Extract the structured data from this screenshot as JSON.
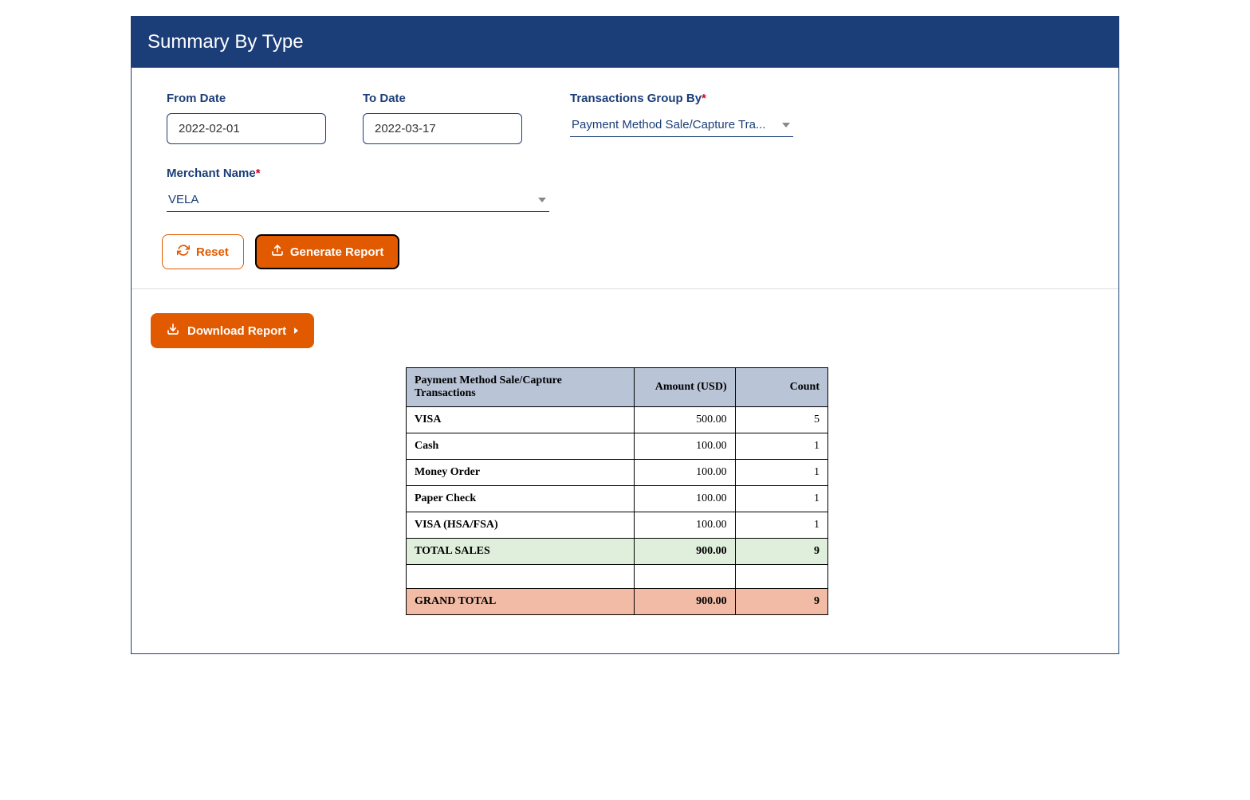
{
  "header": {
    "title": "Summary By Type"
  },
  "form": {
    "from_date": {
      "label": "From Date",
      "value": "2022-02-01"
    },
    "to_date": {
      "label": "To Date",
      "value": "2022-03-17"
    },
    "group_by": {
      "label": "Transactions Group By",
      "value": "Payment Method Sale/Capture Tra..."
    },
    "merchant": {
      "label": "Merchant Name",
      "value": "VELA"
    }
  },
  "buttons": {
    "reset": "Reset",
    "generate": "Generate Report",
    "download": "Download Report"
  },
  "table": {
    "headers": {
      "col1": "Payment Method Sale/Capture Transactions",
      "col2": "Amount (USD)",
      "col3": "Count"
    },
    "rows": [
      {
        "label": "VISA",
        "amount": "500.00",
        "count": "5"
      },
      {
        "label": "Cash",
        "amount": "100.00",
        "count": "1"
      },
      {
        "label": "Money Order",
        "amount": "100.00",
        "count": "1"
      },
      {
        "label": "Paper Check",
        "amount": "100.00",
        "count": "1"
      },
      {
        "label": "VISA (HSA/FSA)",
        "amount": "100.00",
        "count": "1"
      }
    ],
    "total_sales": {
      "label": "TOTAL SALES",
      "amount": "900.00",
      "count": "9"
    },
    "grand_total": {
      "label": "GRAND TOTAL",
      "amount": "900.00",
      "count": "9"
    }
  }
}
